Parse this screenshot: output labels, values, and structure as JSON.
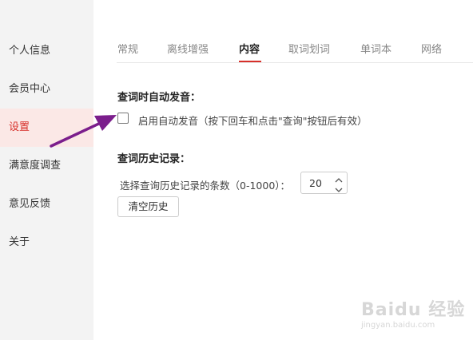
{
  "sidebar": {
    "items": [
      {
        "label": "个人信息"
      },
      {
        "label": "会员中心"
      },
      {
        "label": "设置"
      },
      {
        "label": "满意度调查"
      },
      {
        "label": "意见反馈"
      },
      {
        "label": "关于"
      }
    ],
    "active_index": 2
  },
  "tabs": [
    {
      "label": "常规"
    },
    {
      "label": "离线增强"
    },
    {
      "label": "内容"
    },
    {
      "label": "取词划词"
    },
    {
      "label": "单词本"
    },
    {
      "label": "网络"
    }
  ],
  "active_tab": 2,
  "auto_pronounce": {
    "title": "查词时自动发音：",
    "checkbox_label": "启用自动发音（按下回车和点击\"查询\"按钮后有效）",
    "checked": false
  },
  "history": {
    "title": "查词历史记录：",
    "count_label": "选择查询历史记录的条数（0-1000）：",
    "count_value": "20",
    "clear_button": "清空历史"
  },
  "watermark": {
    "logo_text": "Baidu 经验",
    "url_text": "jingyan.baidu.com"
  },
  "colors": {
    "accent": "#d7302a",
    "arrow": "#7b1e8c",
    "sidebar_bg": "#f3f3f3",
    "active_item_bg": "#fbe8e6"
  }
}
